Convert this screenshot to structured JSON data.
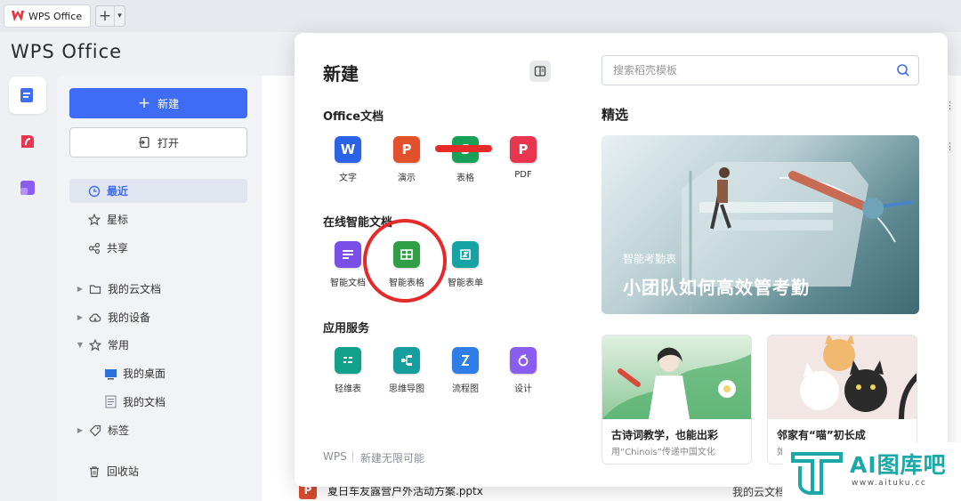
{
  "window": {
    "tab_title": "WPS Office",
    "brand": "WPS Office"
  },
  "sidebar": {
    "new_button": "新建",
    "open_button": "打开",
    "nav": {
      "recent": "最近",
      "starred": "星标",
      "shared": "共享",
      "cloud_docs": "我的云文档",
      "my_devices": "我的设备",
      "common": "常用",
      "desktop": "我的桌面",
      "documents": "我的文档",
      "tags": "标签",
      "recycle": "回收站"
    }
  },
  "background": {
    "file_name": "夏日车友露营户外活动方案.pptx",
    "file_location": "我的云文档"
  },
  "dialog": {
    "title": "新建",
    "sections": {
      "office": {
        "title": "Office文档",
        "apps": [
          {
            "label": "文字",
            "glyph": "W",
            "color": "#2b62e8",
            "icon": "word-icon"
          },
          {
            "label": "演示",
            "glyph": "P",
            "color": "#e2512b",
            "icon": "presentation-icon"
          },
          {
            "label": "表格",
            "glyph": "S",
            "color": "#18a058",
            "icon": "spreadsheet-icon"
          },
          {
            "label": "PDF",
            "glyph": "P",
            "color": "#e8364f",
            "icon": "pdf-icon"
          }
        ]
      },
      "smart": {
        "title": "在线智能文档",
        "apps": [
          {
            "label": "智能文档",
            "color": "#7a4ee8",
            "icon": "smart-doc-icon"
          },
          {
            "label": "智能表格",
            "color": "#2f9e44",
            "icon": "smart-sheet-icon"
          },
          {
            "label": "智能表单",
            "color": "#16a3a3",
            "icon": "smart-form-icon"
          }
        ]
      },
      "services": {
        "title": "应用服务",
        "apps": [
          {
            "label": "轻维表",
            "color": "#12a08a",
            "icon": "light-table-icon"
          },
          {
            "label": "思维导图",
            "color": "#169e9e",
            "icon": "mind-map-icon"
          },
          {
            "label": "流程图",
            "color": "#2f7ee8",
            "icon": "flowchart-icon"
          },
          {
            "label": "设计",
            "color": "#8a5cf0",
            "icon": "design-icon"
          }
        ]
      }
    },
    "footer_brand": "WPS",
    "footer_slogan": "新建无限可能",
    "search_placeholder": "搜索稻壳模板",
    "featured_title": "精选",
    "hero": {
      "subtitle": "智能考勤表",
      "title": "小团队如何高效管考勤"
    },
    "cards": [
      {
        "title": "古诗词教学，也能出彩",
        "subtitle": "用“Chinois”传递中国文化"
      },
      {
        "title": "邻家有“喵”初长成",
        "subtitle": "如"
      }
    ]
  },
  "watermark": {
    "text": "AI图库吧",
    "url": "www.aituku.cc"
  },
  "colors": {
    "accent": "#3e6cf5",
    "annotation_red": "#e52a2a"
  }
}
